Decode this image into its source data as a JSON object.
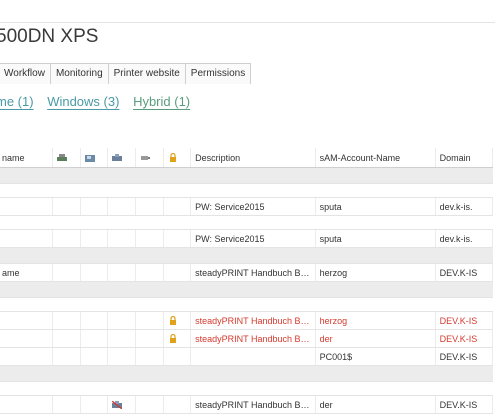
{
  "title": "500DN XPS",
  "tabs": [
    "Workflow",
    "Monitoring",
    "Printer website",
    "Permissions"
  ],
  "filters": [
    "me (1)",
    "Windows (3)",
    "Hybrid (1)"
  ],
  "table": {
    "headers": [
      "name",
      "Description",
      "sAM-Account-Name",
      "Domain"
    ],
    "icon_headers": [
      "printer-icon",
      "fax-icon",
      "scanner-icon",
      "toner-icon",
      "lock-icon"
    ],
    "rows": [
      {
        "type": "group"
      },
      {
        "type": "blank"
      },
      {
        "type": "data",
        "name": "",
        "description": "PW: Service2015",
        "sam": "sputa",
        "domain": "dev.k-is.",
        "lock": false,
        "red": false
      },
      {
        "type": "blank"
      },
      {
        "type": "data",
        "name": "",
        "description": "PW: Service2015",
        "sam": "sputa",
        "domain": "dev.k-is.",
        "lock": false,
        "red": false
      },
      {
        "type": "group"
      },
      {
        "type": "data",
        "name": "ame",
        "description": "steadyPRINT Handbuch Ben...",
        "sam": "herzog",
        "domain": "DEV.K-IS",
        "lock": false,
        "red": false
      },
      {
        "type": "group"
      },
      {
        "type": "blank"
      },
      {
        "type": "data",
        "name": "",
        "description": "steadyPRINT Handbuch Ben...",
        "sam": "herzog",
        "domain": "DEV.K-IS",
        "lock": true,
        "red": true
      },
      {
        "type": "data",
        "name": "",
        "description": "steadyPRINT Handbuch Ben...",
        "sam": "der",
        "domain": "DEV.K-IS",
        "lock": true,
        "red": true
      },
      {
        "type": "data",
        "name": "",
        "description": "",
        "sam": "PC001$",
        "domain": "DEV.K-IS",
        "lock": false,
        "red": false
      },
      {
        "type": "group"
      },
      {
        "type": "blank"
      },
      {
        "type": "data",
        "name": "",
        "description": "steadyPRINT Handbuch Ben...",
        "sam": "der",
        "domain": "DEV.K-IS",
        "lock": false,
        "red": false,
        "scanner_disabled": true
      }
    ]
  },
  "colors": {
    "accent_teal": "#4a9aa6",
    "accent_green": "#5a9c7e",
    "error_red": "#d63a2e",
    "lock_orange": "#e0a21a"
  }
}
